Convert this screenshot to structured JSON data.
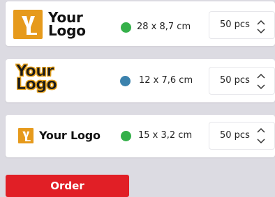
{
  "items": [
    {
      "logo_text": "Your\nLogo",
      "size": "28 x 8,7 cm",
      "size_color": "#35b04a",
      "quantity": "50 pcs"
    },
    {
      "logo_text": "Your\nLogo",
      "size": "12 x 7,6 cm",
      "size_color": "#3b82ad",
      "quantity": "50 pcs"
    },
    {
      "logo_text": "Your Logo",
      "size": "15 x 3,2 cm",
      "size_color": "#35b04a",
      "quantity": "50 pcs"
    }
  ],
  "colors": {
    "accent": "#e11f26",
    "logo_orange": "#e69a1c"
  },
  "icons": {
    "stepper_up": "chevron-up-icon",
    "stepper_down": "chevron-down-icon"
  },
  "order_button": {
    "label": "Order"
  }
}
